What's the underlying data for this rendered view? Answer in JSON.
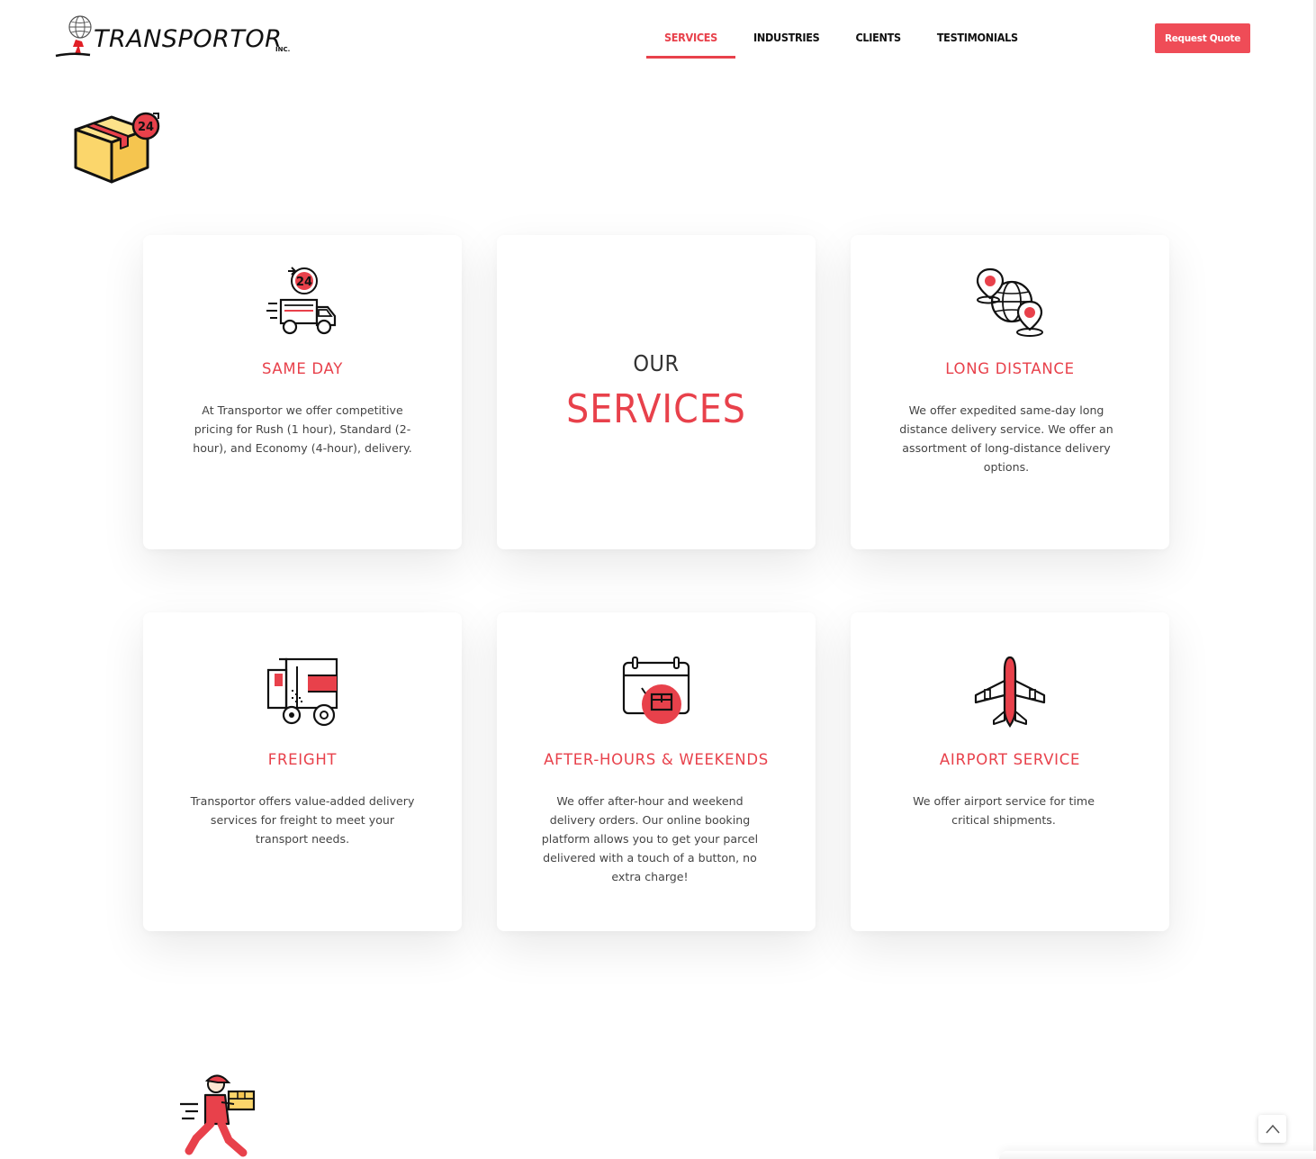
{
  "brand": {
    "logo_text": "TRANSPORTOR",
    "logo_suffix": "INC."
  },
  "nav": {
    "items": [
      {
        "label": "SERVICES",
        "active": true
      },
      {
        "label": "INDUSTRIES",
        "active": false
      },
      {
        "label": "CLIENTS",
        "active": false
      },
      {
        "label": "TESTIMONIALS",
        "active": false
      }
    ]
  },
  "header": {
    "quote_button": "Request Quote"
  },
  "colors": {
    "accent": "#e8414b",
    "button": "#ef4c57",
    "text_dark": "#111111",
    "icon_yellow": "#fbd66b"
  },
  "section": {
    "heading_small": "OUR",
    "heading_large": "SERVICES"
  },
  "services": [
    {
      "title": "SAME DAY",
      "text": "At Transportor we offer competitive pricing for Rush (1 hour), Standard (2-hour), and Economy (4-hour), delivery.",
      "icon": "same-day-truck-icon"
    },
    {
      "title": "LONG DISTANCE",
      "text": "We offer expedited same-day long distance delivery service. We offer an assortment of long-distance delivery options.",
      "icon": "globe-pin-icon"
    },
    {
      "title": "FREIGHT",
      "text": "Transportor offers value-added delivery services for freight to meet your transport needs.",
      "icon": "freight-truck-icon"
    },
    {
      "title": "AFTER-HOURS & WEEKENDS",
      "text": "We offer after-hour and weekend delivery orders.  Our online booking platform allows you to get your parcel delivered with a touch of a button, no extra charge!",
      "icon": "calendar-box-icon"
    },
    {
      "title": "AIRPORT SERVICE",
      "text": "We offer airport service for time critical shipments.",
      "icon": "airplane-icon"
    }
  ],
  "decor": {
    "top_icon": "box-24-icon",
    "bottom_icon": "courier-runner-icon"
  },
  "scroll_top_icon": "arrow-up-icon"
}
